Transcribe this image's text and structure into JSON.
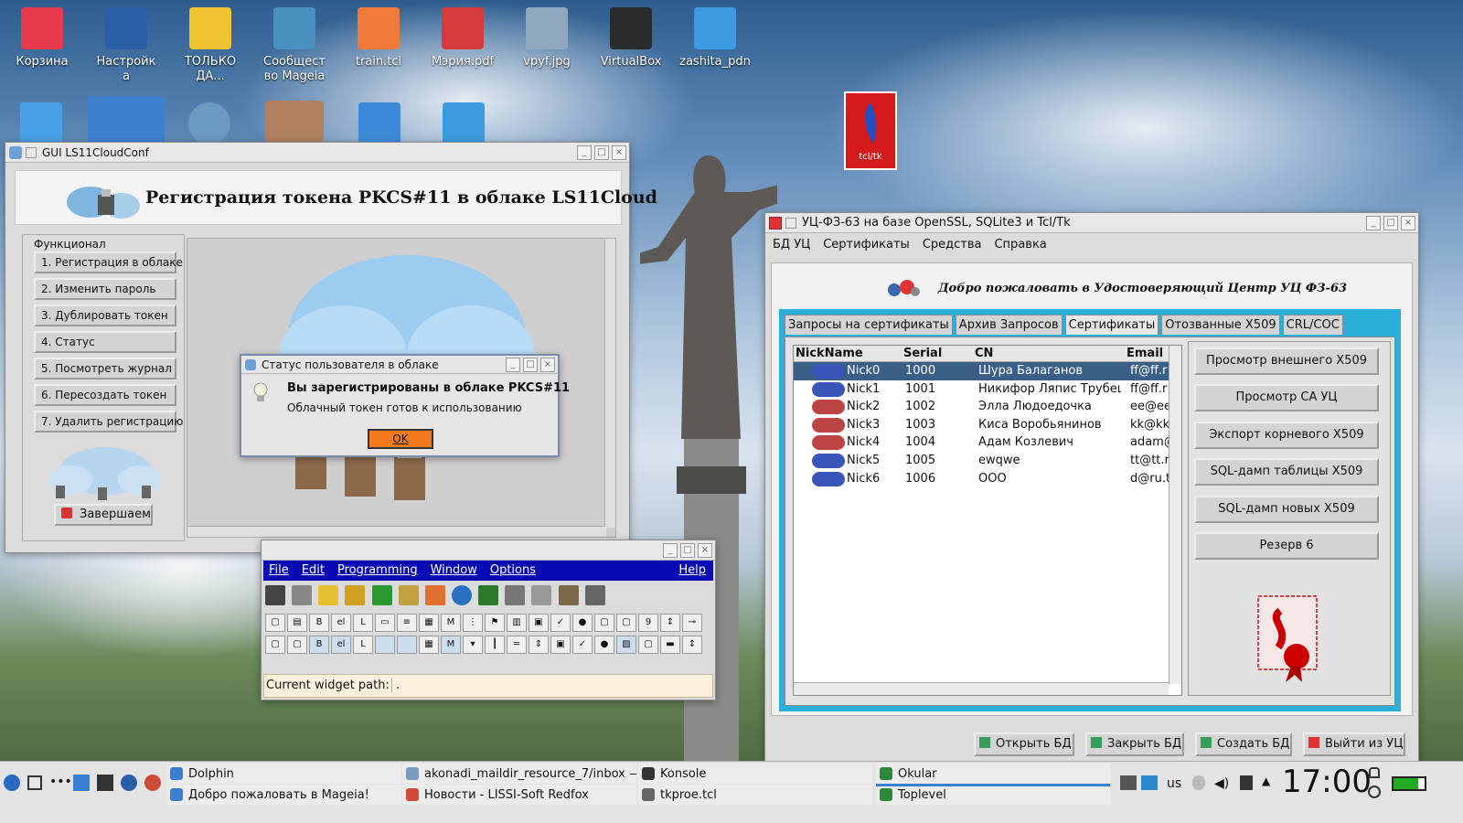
{
  "desktop": {
    "icons": [
      {
        "label": "Корзина",
        "icon": "trash-icon",
        "color": "#e8394d"
      },
      {
        "label": "Настройк\nа",
        "icon": "settings-gear-icon",
        "color": "#2a5fa8"
      },
      {
        "label": "ТОЛЬКО\nДА...",
        "icon": "folder-yellow-icon",
        "color": "#f0c430"
      },
      {
        "label": "Сообщест\nво Mageia",
        "icon": "mageia-icon",
        "color": "#4a90c0"
      },
      {
        "label": "train.tcl",
        "icon": "script-icon",
        "color": "#f07a3a"
      },
      {
        "label": "Мэрия.pdf",
        "icon": "pdf-icon",
        "color": "#d63a3a"
      },
      {
        "label": "vpyf.jpg",
        "icon": "image-icon",
        "color": "#8fa8c0"
      },
      {
        "label": "VirtualBox",
        "icon": "virtualbox-icon",
        "color": "#2b2b2b"
      },
      {
        "label": "zashita_pdn",
        "icon": "html-file-icon",
        "color": "#3c9be0"
      }
    ]
  },
  "ls11": {
    "title": "GUI LS11CloudConf",
    "header": "Регистрация токена PKCS#11 в облаке LS11Cloud",
    "group_label": "Функционал",
    "menu": [
      "1. Регистрация в облаке",
      "2. Изменить пароль",
      "3. Дублировать токен",
      "4. Статус",
      "5. Посмотреть журнал",
      "6. Пересоздать токен",
      "7. Удалить регистрацию"
    ],
    "finish": "Завершаем"
  },
  "dialog": {
    "title": "Статус пользователя в облаке",
    "heading": "Вы зарегистрированы в облаке PKCS#11",
    "message": "Облачный токен готов к использованию",
    "ok": "OK"
  },
  "tkproe": {
    "menu": [
      "File",
      "Edit",
      "Programming",
      "Window",
      "Options"
    ],
    "help": "Help",
    "path_label": "Current widget path:",
    "path_value": "."
  },
  "uc": {
    "title": "УЦ-ФЗ-63 на базе OpenSSL, SQLite3 и Tcl/Tk",
    "menu": [
      "БД УЦ",
      "Сертификаты",
      "Средства",
      "Справка"
    ],
    "welcome": "Добро пожаловать в Удостоверяющий Центр УЦ ФЗ-63",
    "tabs": [
      "Запросы на сертификаты",
      "Архив Запросов",
      "Сертификаты",
      "Отозванные X509",
      "CRL/COC"
    ],
    "active_tab": 2,
    "columns": [
      "NickName",
      "Serial",
      "CN",
      "Email"
    ],
    "rows": [
      {
        "nick": "Nick0",
        "serial": "1000",
        "cn": "Шура Балаганов",
        "email": "ff@ff.r",
        "revoked": true,
        "selected": true
      },
      {
        "nick": "Nick1",
        "serial": "1001",
        "cn": "Никифор Ляпис Трубецк",
        "email": "ff@ff.r",
        "revoked": true
      },
      {
        "nick": "Nick2",
        "serial": "1002",
        "cn": "Элла Людоедочка",
        "email": "ee@ee",
        "revoked": false
      },
      {
        "nick": "Nick3",
        "serial": "1003",
        "cn": "Киса Воробьянинов",
        "email": "kk@kk",
        "revoked": false
      },
      {
        "nick": "Nick4",
        "serial": "1004",
        "cn": "Адам Козлевич",
        "email": "adam@",
        "revoked": false
      },
      {
        "nick": "Nick5",
        "serial": "1005",
        "cn": "ewqwe",
        "email": "tt@tt.r",
        "revoked": true
      },
      {
        "nick": "Nick6",
        "serial": "1006",
        "cn": "OOO",
        "email": "d@ru.t",
        "revoked": true
      }
    ],
    "side_buttons": [
      "Просмотр внешнего X509",
      "Просмотр CA УЦ",
      "Экспорт корневого X509",
      "SQL-дамп таблицы X509",
      "SQL-дамп новых X509",
      "Резерв 6"
    ],
    "bottom_buttons": [
      "Открыть БД",
      "Закрыть БД",
      "Создать БД",
      "Выйти из УЦ"
    ]
  },
  "taskbar": {
    "tasks": [
      {
        "label": "Dolphin",
        "color": "#3a7fd0"
      },
      {
        "label": "Добро пожаловать в Mageia!",
        "color": "#3a7fd0"
      },
      {
        "label": "akonadi_maildir_resource_7/inbox — ...",
        "color": "#7a9ac0"
      },
      {
        "label": "Новости - LISSI-Soft Redfox",
        "color": "#d04a3a"
      },
      {
        "label": "Konsole",
        "color": "#333"
      },
      {
        "label": "tkproe.tcl",
        "color": "#666"
      },
      {
        "label": "Okular",
        "color": "#2a8a3a"
      },
      {
        "label": "Toplevel",
        "color": "#2a8a3a"
      }
    ],
    "lang": "us",
    "clock": "17:00"
  }
}
